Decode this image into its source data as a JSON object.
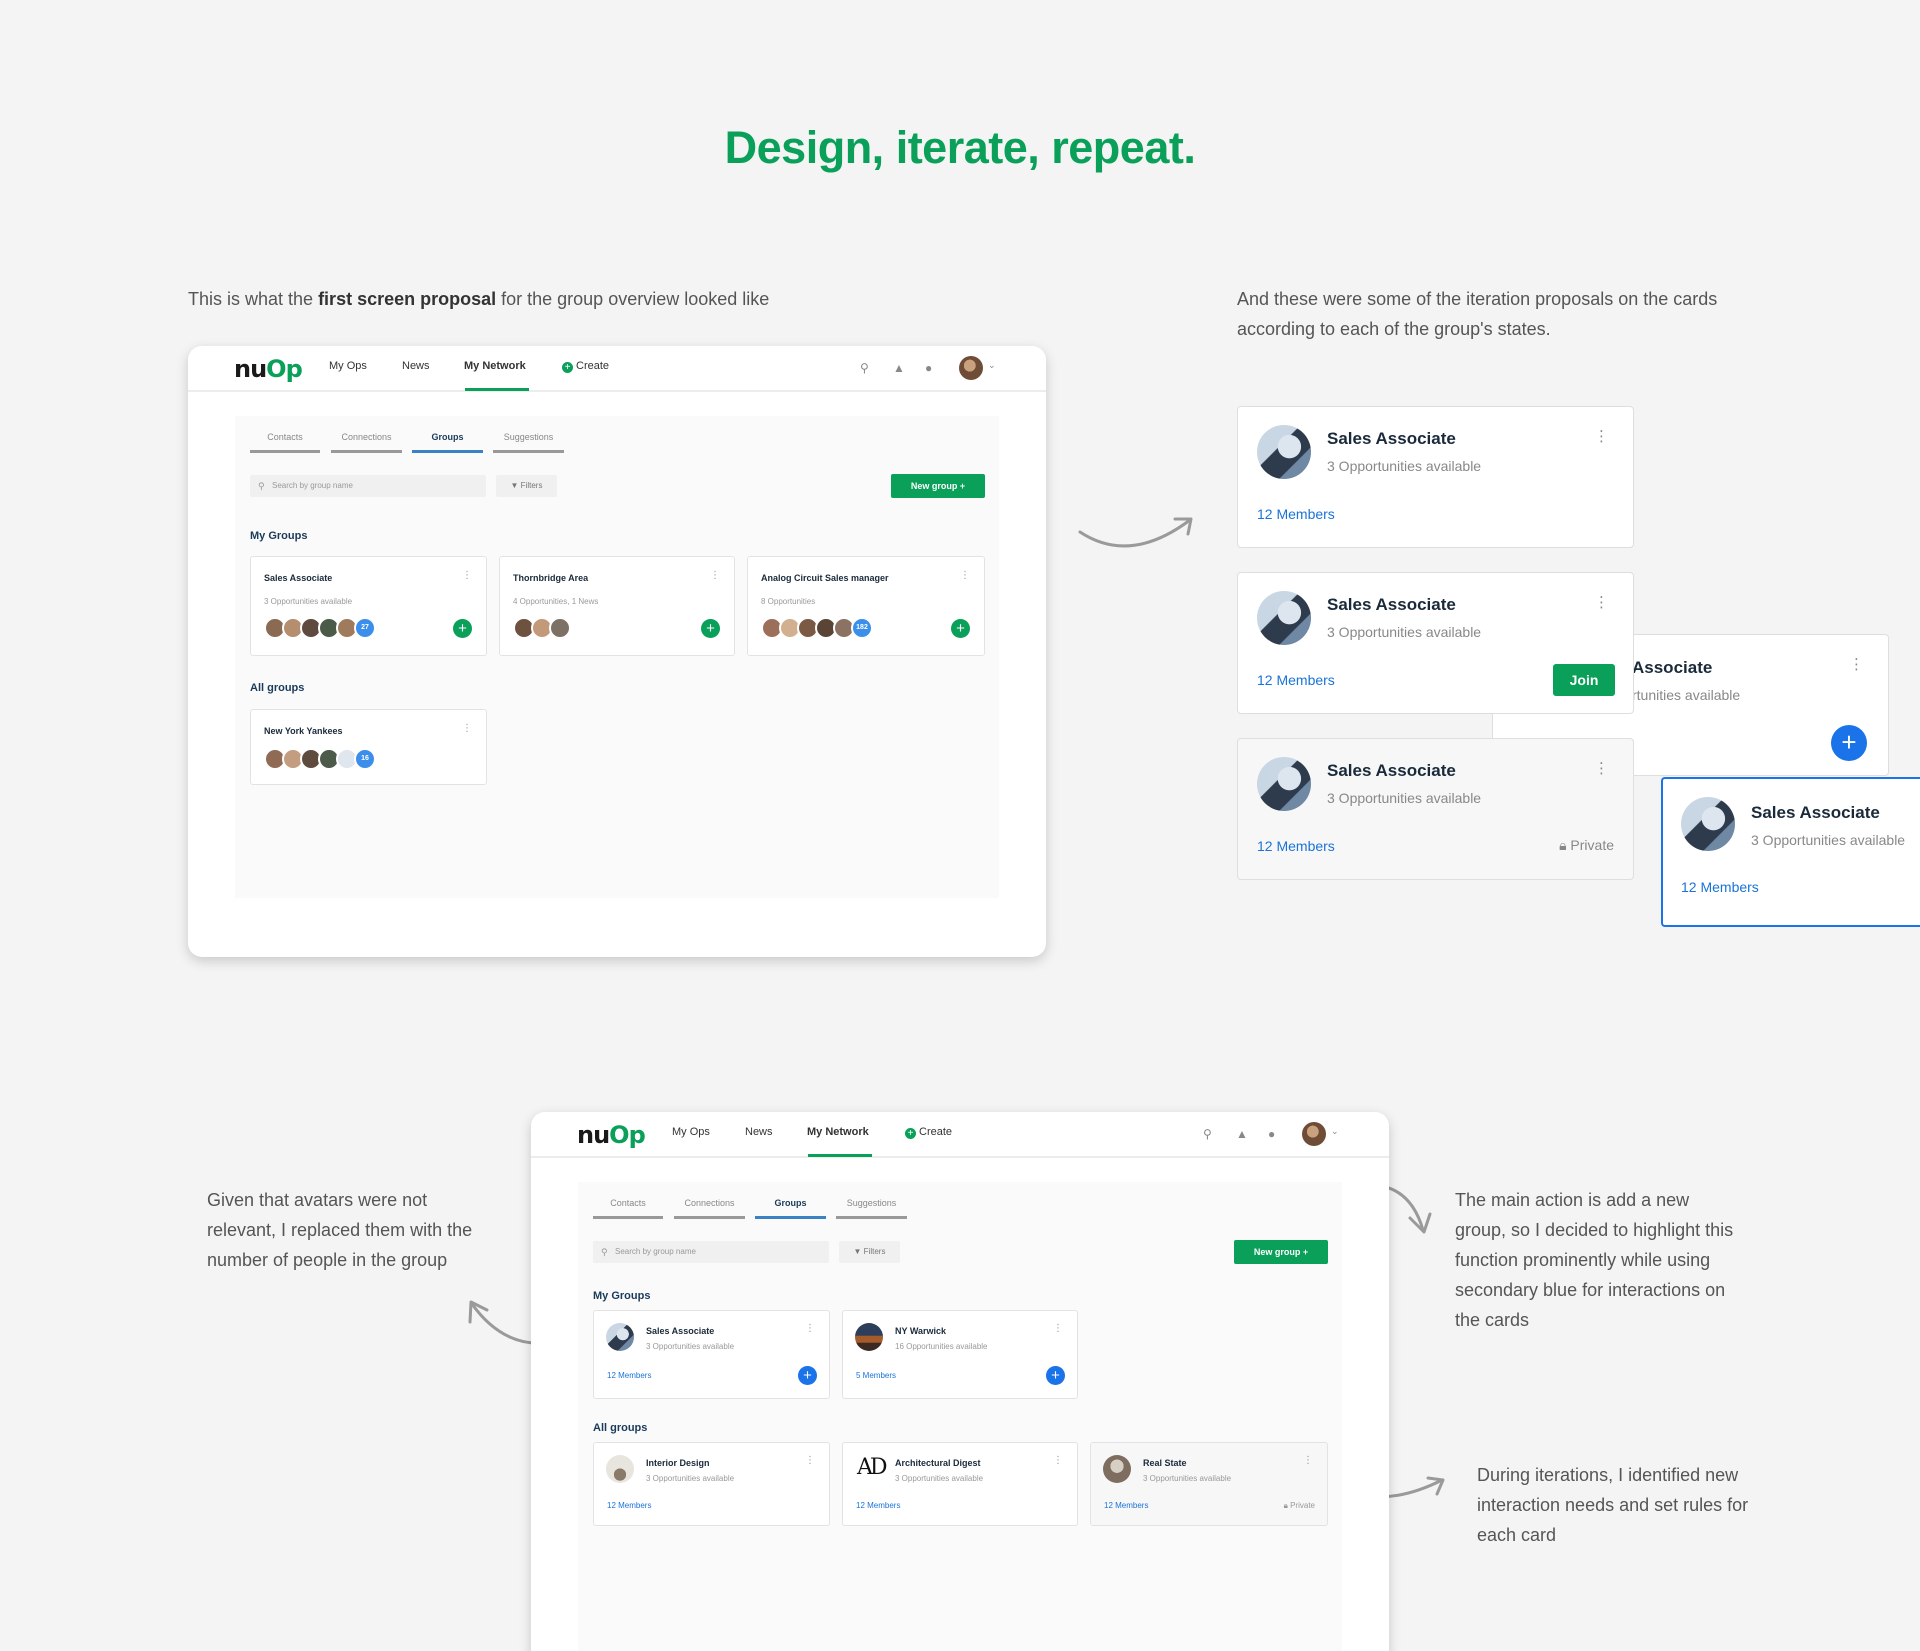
{
  "headline": "Design, iterate, repeat.",
  "captions": {
    "first_pre": "This is what the ",
    "first_bold": "first screen proposal",
    "first_post": " for the group overview looked like",
    "iter_line1": "And these were some of the iteration proposals on the cards",
    "iter_line2": "according to each of the group's states.",
    "avatars": [
      "Given that avatars were not",
      "relevant, I replaced them with the",
      "number of people in the group"
    ],
    "main_action": [
      "The main action is add a new",
      "group, so I decided to highlight this",
      "function prominently while using",
      "secondary blue for interactions on",
      "the cards"
    ],
    "during": [
      "During iterations, I identified new",
      "interaction needs and set rules for",
      "each card"
    ]
  },
  "nav": {
    "logo_a": "nu",
    "logo_b": "Op",
    "links": [
      "My Ops",
      "News",
      "My Network"
    ],
    "create": "Create"
  },
  "tabs": [
    "Contacts",
    "Connections",
    "Groups",
    "Suggestions"
  ],
  "search_placeholder": "Search by group name",
  "filters": "Filters",
  "new_group": "New group  +",
  "my_groups": "My Groups",
  "all_groups": "All groups",
  "v1": {
    "my_groups": [
      {
        "title": "Sales Associate",
        "sub": "3 Opportunities available",
        "count": "27"
      },
      {
        "title": "Thornbridge Area",
        "sub": "4 Opportunities, 1 News",
        "count": ""
      },
      {
        "title": "Analog Circuit Sales manager",
        "sub": "8 Opportunities",
        "count": "182"
      }
    ],
    "all_groups": [
      {
        "title": "New York Yankees",
        "count": "16"
      }
    ]
  },
  "states": {
    "title": "Sales Associate",
    "sub": "3 Opportunities available",
    "members": "12 Members",
    "join": "Join",
    "private": "Private",
    "partial_title": "Associate",
    "partial_sub": "rtunities available"
  },
  "v2": {
    "my_groups": [
      {
        "title": "Sales Associate",
        "sub": "3 Opportunities available",
        "members": "12 Members"
      },
      {
        "title": "NY Warwick",
        "sub": "16 Opportunities available",
        "members": "5 Members"
      }
    ],
    "all_groups": [
      {
        "title": "Interior Design",
        "sub": "3 Opportunities available",
        "members": "12 Members"
      },
      {
        "title": "Architectural Digest",
        "sub": "3 Opportunities available",
        "members": "12 Members",
        "logo": "AD"
      },
      {
        "title": "Real State",
        "sub": "3 Opportunities available",
        "members": "12 Members",
        "private": "Private"
      }
    ]
  },
  "colors": {
    "brand_green": "#0aa05a",
    "secondary_blue": "#1a73e8"
  }
}
